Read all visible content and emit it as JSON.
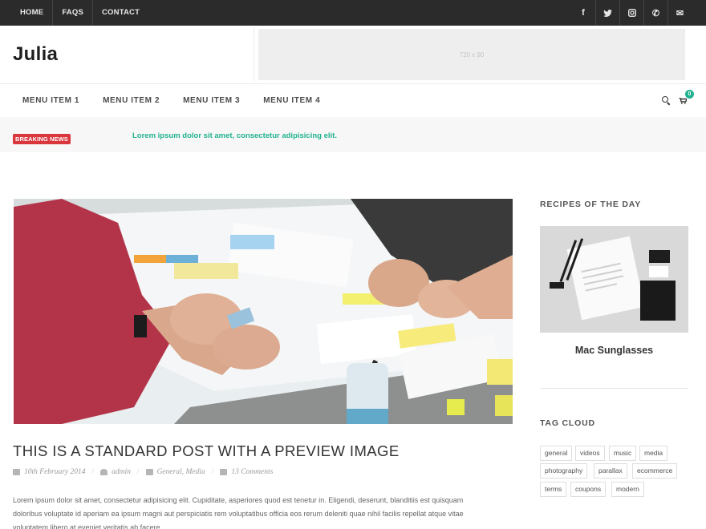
{
  "topbar": {
    "links": [
      "HOME",
      "FAQS",
      "CONTACT"
    ],
    "social_icons": [
      "facebook-icon",
      "twitter-icon",
      "instagram-icon",
      "phone-icon",
      "email-icon"
    ],
    "social_glyphs": [
      "f",
      "t",
      "◎",
      "✆",
      "✉"
    ]
  },
  "header": {
    "logo": "Julia",
    "ad_label": "720 x 90"
  },
  "nav": {
    "items": [
      "MENU ITEM 1",
      "MENU ITEM 2",
      "MENU ITEM 3",
      "MENU ITEM 4"
    ],
    "cart_count": "0"
  },
  "breaking": {
    "badge": "BREAKING NEWS",
    "text": "Lorem ipsum dolor sit amet, consectetur adipisicing elit."
  },
  "post": {
    "title": "THIS IS A STANDARD POST WITH A PREVIEW IMAGE",
    "date": "10th February 2014",
    "author": "admin",
    "categories": "General, Media",
    "comments": "13 Comments",
    "excerpt": "Lorem ipsum dolor sit amet, consectetur adipisicing elit. Cupiditate, asperiores quod est tenetur in. Eligendi, deserunt, blanditiis est quisquam doloribus voluptate id aperiam ea ipsum magni aut perspiciatis rem voluptatibus officia eos rerum deleniti quae nihil facilis repellat atque vitae voluptatem libero at eveniet veritatis ab facere."
  },
  "sidebar": {
    "recipes_title": "RECIPES OF THE DAY",
    "recipe_name": "Mac Sunglasses",
    "tagcloud_title": "TAG CLOUD",
    "tags": [
      "general",
      "videos",
      "music",
      "media",
      "photography",
      "parallax",
      "ecommerce",
      "terms",
      "coupons",
      "modern"
    ]
  },
  "colors": {
    "accent": "#21b28f",
    "breaking": "#d9363e",
    "topbar": "#2b2b2b"
  }
}
